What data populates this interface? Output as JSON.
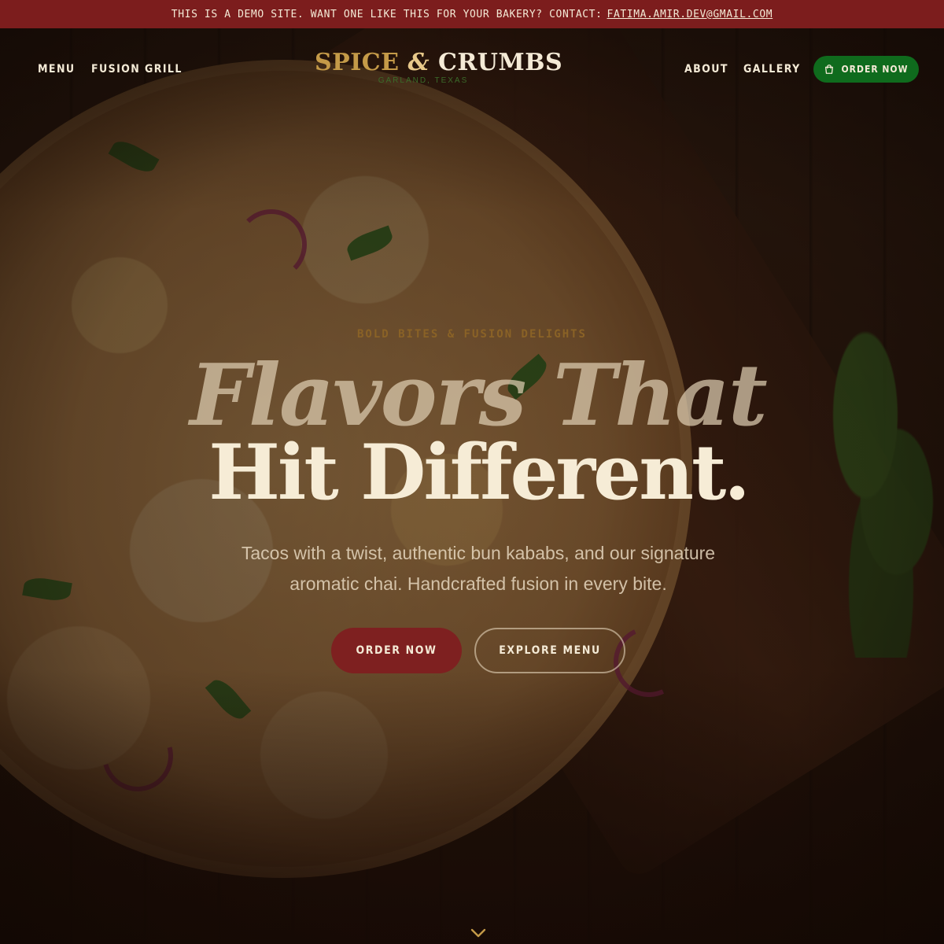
{
  "announcement": {
    "text": "THIS IS A DEMO SITE. WANT ONE LIKE THIS FOR YOUR BAKERY? CONTACT:",
    "email": "FATIMA.AMIR.DEV@GMAIL.COM"
  },
  "nav": {
    "left_links": [
      "MENU",
      "FUSION GRILL"
    ],
    "right_links": [
      "ABOUT",
      "GALLERY"
    ],
    "order_button": "ORDER NOW",
    "order_icon": "shopping-bag-icon"
  },
  "logo": {
    "spice": "SPICE",
    "amp": "&",
    "crumbs": "CRUMBS",
    "location": "GARLAND, TEXAS"
  },
  "hero": {
    "eyebrow": "BOLD BITES & FUSION DELIGHTS",
    "headline_line1": "Flavors That",
    "headline_line2": "Hit Different.",
    "subtitle": "Tacos with a twist, authentic bun kababs, and our signature aromatic chai. Handcrafted fusion in every bite.",
    "primary_button": "ORDER NOW",
    "secondary_button": "EXPLORE MENU",
    "scroll_icon": "chevron-down-icon"
  },
  "colors": {
    "announcement_bg": "#7c1d1d",
    "nav_order_bg": "#0f6b1d",
    "primary_button_bg": "#7e2020",
    "accent_gold": "#c49a48",
    "cream": "#f4ead6"
  }
}
